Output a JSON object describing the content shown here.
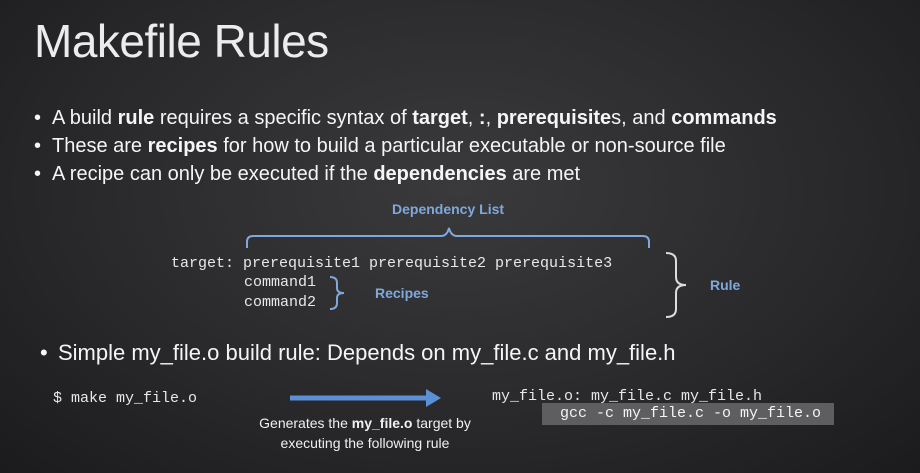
{
  "slide": {
    "title": "Makefile Rules",
    "bullets": [
      {
        "parts": [
          "A build ",
          "rule",
          " requires a specific syntax of ",
          "target",
          ", ",
          ":",
          ", ",
          "prerequisite",
          "s, and ",
          "commands"
        ]
      },
      {
        "parts": [
          "These are ",
          "recipes",
          " for how to build a particular executable or non-source file"
        ]
      },
      {
        "parts": [
          "A recipe can only be executed if the ",
          "dependencies",
          " are met"
        ]
      }
    ],
    "bullet_symbol": "•"
  },
  "diagram": {
    "dependency_list_label": "Dependency List",
    "rule_line": "target: prerequisite1 prerequisite2 prerequisite3",
    "command1": "command1",
    "command2": "command2",
    "recipes_label": "Recipes",
    "rule_label": "Rule",
    "label_color": "#7fa8dc"
  },
  "example": {
    "heading": "Simple my_file.o build rule: Depends on my_file.c and my_file.h",
    "command": "$ make my_file.o",
    "note_prefix": "Generates the ",
    "note_bold": "my_file.o",
    "note_suffix": " target by",
    "note_line2": "executing the following rule",
    "rule_line": "my_file.o: my_file.c my_file.h",
    "recipe_line": "gcc -c my_file.c -o my_file.o",
    "arrow_color": "#5b8fd6"
  }
}
